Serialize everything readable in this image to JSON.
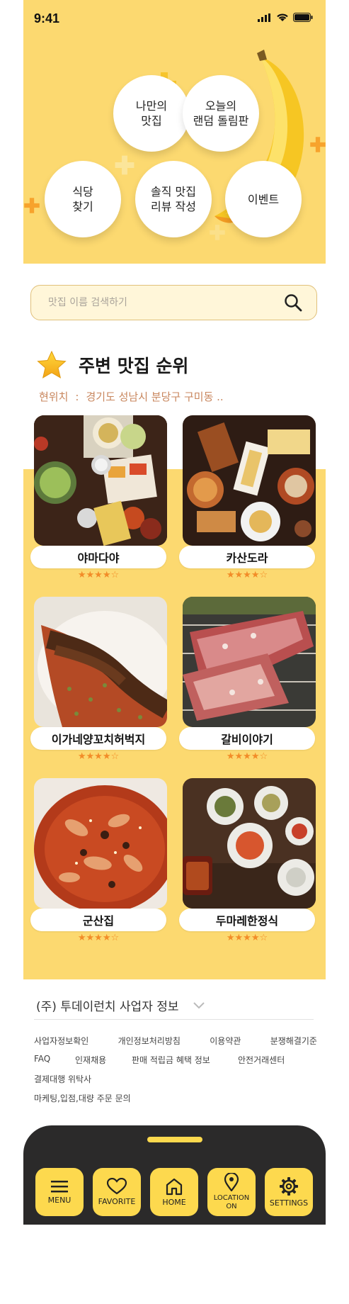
{
  "status": {
    "time": "9:41"
  },
  "menu_bubbles": [
    {
      "label_line1": "나만의",
      "label_line2": "맛집"
    },
    {
      "label_line1": "오늘의",
      "label_line2": "랜덤 돌림판"
    },
    {
      "label_line1": "식당",
      "label_line2": "찾기"
    },
    {
      "label_line1": "솔직 맛집",
      "label_line2": "리뷰 작성"
    },
    {
      "label_line1": "이벤트",
      "label_line2": ""
    }
  ],
  "search": {
    "placeholder": "맛집 이름 검색하기"
  },
  "ranking": {
    "title": "주변 맛집 순위",
    "location_label": "현위치",
    "location_sep": ":",
    "location_value": "경기도 성남시 분당구 구미동 .."
  },
  "restaurants": [
    {
      "name": "야마다야",
      "stars": "★★★★☆"
    },
    {
      "name": "카산도라",
      "stars": "★★★★☆"
    },
    {
      "name": "이가네양꼬치허벅지",
      "stars": "★★★★☆"
    },
    {
      "name": "갈비이야기",
      "stars": "★★★★☆"
    },
    {
      "name": "군산집",
      "stars": "★★★★☆"
    },
    {
      "name": "두마레한정식",
      "stars": "★★★★☆"
    }
  ],
  "footer": {
    "biz_info": "(주) 투데이런치 사업자 정보",
    "links_row1": [
      "사업자정보확인",
      "개인정보처리방침",
      "이용약관",
      "분쟁해결기준"
    ],
    "links_row2": [
      "FAQ",
      "인재채용",
      "판매 적립금 혜택 정보",
      "안전거래센터"
    ],
    "links_row3": [
      "결제대행 위탁사"
    ],
    "links_row4": [
      "마케팅,입점,대량 주문 문의"
    ]
  },
  "nav": [
    {
      "label": "MENU",
      "icon": "menu-icon"
    },
    {
      "label": "FAVORITE",
      "icon": "heart-icon"
    },
    {
      "label": "HOME",
      "icon": "home-icon"
    },
    {
      "label_line1": "LOCATION",
      "label_line2": "ON",
      "icon": "location-pin-icon"
    },
    {
      "label": "SETTINGS",
      "icon": "gear-icon"
    }
  ],
  "colors": {
    "accent_yellow": "#fcd970",
    "nav_dark": "#2b2a2a",
    "nav_button": "#fdd94e",
    "star_orange": "#f28c28"
  }
}
